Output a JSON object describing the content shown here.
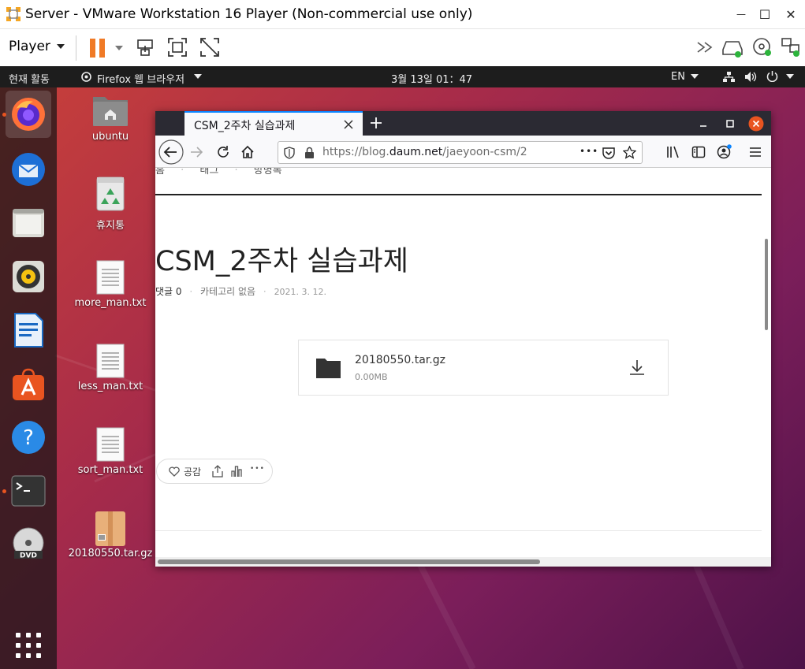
{
  "vmware": {
    "title": "Server - VMware Workstation 16 Player (Non-commercial use only)",
    "player_menu": "Player",
    "window_controls": {
      "minimize": "—",
      "maximize": "☐",
      "close": "✕"
    }
  },
  "ubuntu_topbar": {
    "activities": "현재 활동",
    "app_menu": "Firefox 웹 브라우저",
    "clock": "3월 13일  01：47",
    "lang": "EN"
  },
  "desktop_icons": [
    {
      "label": "ubuntu",
      "icon": "home-folder-icon"
    },
    {
      "label": "휴지통",
      "icon": "trash-icon"
    },
    {
      "label": "more_man.txt",
      "icon": "text-file-icon"
    },
    {
      "label": "less_man.txt",
      "icon": "text-file-icon"
    },
    {
      "label": "sort_man.txt",
      "icon": "text-file-icon"
    },
    {
      "label": "20180550.tar.gz",
      "icon": "archive-icon"
    }
  ],
  "dock": [
    {
      "name": "firefox",
      "icon": "firefox-icon",
      "running": true
    },
    {
      "name": "thunderbird",
      "icon": "thunderbird-icon",
      "running": false
    },
    {
      "name": "files",
      "icon": "files-icon",
      "running": false
    },
    {
      "name": "rhythmbox",
      "icon": "rhythmbox-icon",
      "running": false
    },
    {
      "name": "writer",
      "icon": "writer-icon",
      "running": false
    },
    {
      "name": "software",
      "icon": "software-center-icon",
      "running": false
    },
    {
      "name": "help",
      "icon": "help-icon",
      "running": false
    },
    {
      "name": "terminal",
      "icon": "terminal-icon",
      "running": true
    },
    {
      "name": "dvd",
      "icon": "dvd-icon",
      "running": false
    },
    {
      "name": "apps",
      "icon": "app-grid-icon",
      "running": false
    }
  ],
  "firefox": {
    "tab_title": "CSM_2주차 실습과제",
    "url_prefix": "https://blog.",
    "url_domain": "daum.net",
    "url_path": "/jaeyoon-csm/2",
    "url_more": "•••",
    "nav_links": [
      "홈",
      "태그",
      "방명록"
    ],
    "post": {
      "title": "CSM_2주차 실습과제",
      "comments": "댓글 0",
      "category": "카테고리 없음",
      "date": "2021. 3. 12.",
      "sep": "·",
      "attachment": {
        "name": "20180550.tar.gz",
        "size": "0.00MB"
      },
      "like_label": "공감",
      "more": "•••"
    }
  },
  "colors": {
    "ubuntu_orange": "#e95420",
    "firefox_tabbar": "#2b2a33",
    "accent_blue": "#0a84ff"
  }
}
